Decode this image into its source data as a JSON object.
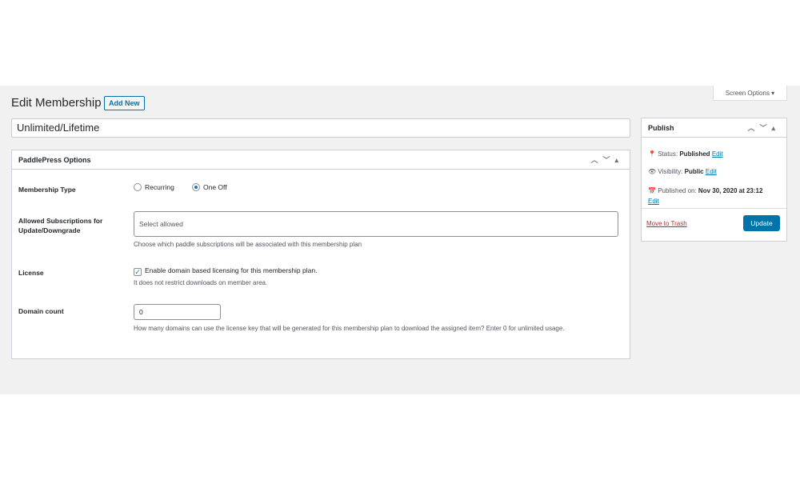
{
  "header": {
    "title": "Edit Membership",
    "add_new": "Add New",
    "screen_options": "Screen Options ▾"
  },
  "post_title": "Unlimited/Lifetime",
  "options": {
    "title": "PaddlePress Options",
    "membership_type": {
      "label": "Membership Type",
      "options": [
        "Recurring",
        "One Off"
      ],
      "selected": "One Off"
    },
    "allowed": {
      "label": "Allowed Subscriptions for Update/Downgrade",
      "placeholder": "Select allowed",
      "description": "Choose which paddle subscriptions will be associated with this membership plan"
    },
    "license": {
      "label": "License",
      "checkbox_label": "Enable domain based licensing for this membership plan.",
      "checked": true,
      "description": "It does not restrict downloads on member area."
    },
    "domain_count": {
      "label": "Domain count",
      "value": "0",
      "description": "How many domains can use the license key that will be generated for this membership plan to download the assigned item? Enter 0 for unlimited usage."
    }
  },
  "publish": {
    "title": "Publish",
    "status_label": "Status:",
    "status": "Published",
    "visibility_label": "Visibility:",
    "visibility": "Public",
    "published_label": "Published on:",
    "published": "Nov 30, 2020 at 23:12",
    "edit": "Edit",
    "trash": "Move to Trash",
    "update": "Update"
  }
}
